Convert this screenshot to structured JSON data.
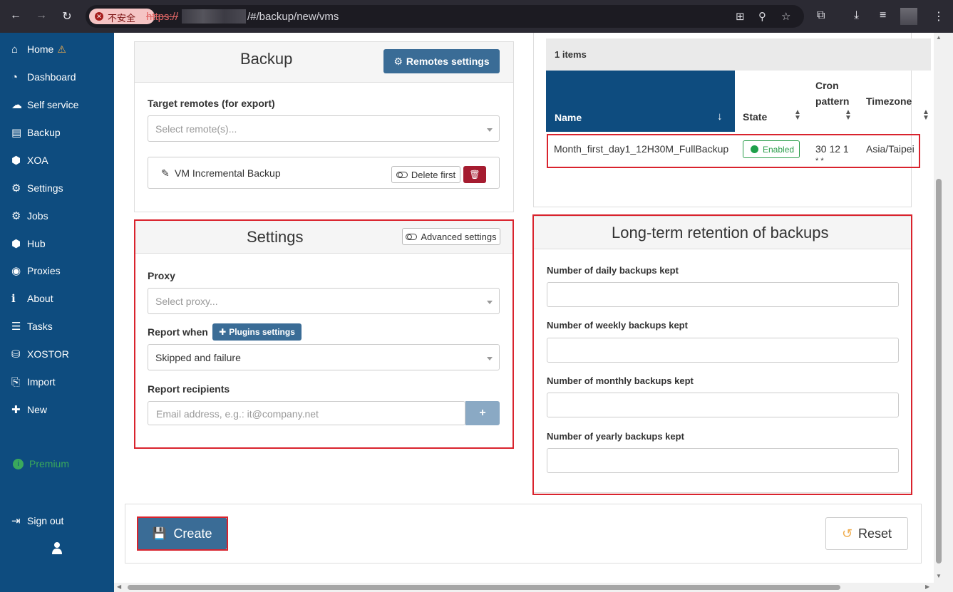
{
  "browser": {
    "not_secure": "不安全",
    "url_scheme": "https://",
    "url_path": "/#/backup/new/vms"
  },
  "sidebar": {
    "items": [
      {
        "label": "Home",
        "icon": "home-icon",
        "glyph": "⌂"
      },
      {
        "label": "Dashboard",
        "icon": "dashboard-icon",
        "glyph": "◔"
      },
      {
        "label": "Self service",
        "icon": "cloud-icon",
        "glyph": "☁"
      },
      {
        "label": "Backup",
        "icon": "archive-icon",
        "glyph": "▤"
      },
      {
        "label": "XOA",
        "icon": "cube-icon",
        "glyph": "⬢"
      },
      {
        "label": "Settings",
        "icon": "gear-icon",
        "glyph": "⚙"
      },
      {
        "label": "Jobs",
        "icon": "gears-icon",
        "glyph": "⚙"
      },
      {
        "label": "Hub",
        "icon": "cubes-icon",
        "glyph": "⬢"
      },
      {
        "label": "Proxies",
        "icon": "globe-icon",
        "glyph": "◉"
      },
      {
        "label": "About",
        "icon": "info-icon",
        "glyph": "ℹ"
      },
      {
        "label": "Tasks",
        "icon": "tasks-icon",
        "glyph": "☰"
      },
      {
        "label": "XOSTOR",
        "icon": "database-icon",
        "glyph": "⛁"
      },
      {
        "label": "Import",
        "icon": "file-import-icon",
        "glyph": "⎘"
      },
      {
        "label": "New",
        "icon": "plus-icon",
        "glyph": "✚"
      }
    ],
    "premium": "Premium",
    "sign_out": "Sign out"
  },
  "backup_panel": {
    "title": "Backup",
    "remotes_settings": "Remotes settings",
    "target_label": "Target remotes (for export)",
    "target_placeholder": "Select remote(s)...",
    "mode_label": "VM Incremental Backup",
    "delete_first": "Delete first"
  },
  "settings_panel": {
    "title": "Settings",
    "advanced": "Advanced settings",
    "proxy_label": "Proxy",
    "proxy_placeholder": "Select proxy...",
    "report_when_label": "Report when",
    "plugins_settings": "Plugins settings",
    "report_when_value": "Skipped and failure",
    "recipients_label": "Report recipients",
    "recipients_placeholder": "Email address, e.g.: it@company.net"
  },
  "schedule_table": {
    "count": "1 items",
    "headers": {
      "name": "Name",
      "state": "State",
      "cron_1": "Cron",
      "cron_2": "pattern",
      "timezone": "Timezone"
    },
    "row": {
      "name": "Month_first_day1_12H30M_FullBackup",
      "state": "Enabled",
      "cron_1": "30 12 1",
      "cron_2": "* *",
      "timezone": "Asia/Taipei"
    }
  },
  "retention_panel": {
    "title": "Long-term retention of backups",
    "daily": "Number of daily backups kept",
    "weekly": "Number of weekly backups kept",
    "monthly": "Number of monthly backups kept",
    "yearly": "Number of yearly backups kept"
  },
  "footer": {
    "create": "Create",
    "reset": "Reset"
  },
  "colors": {
    "sidebar": "#0e4c7f",
    "primary_button": "#3a6c96",
    "danger": "#a51c30",
    "enabled": "#2a9d4a",
    "highlight": "#d9232d"
  }
}
